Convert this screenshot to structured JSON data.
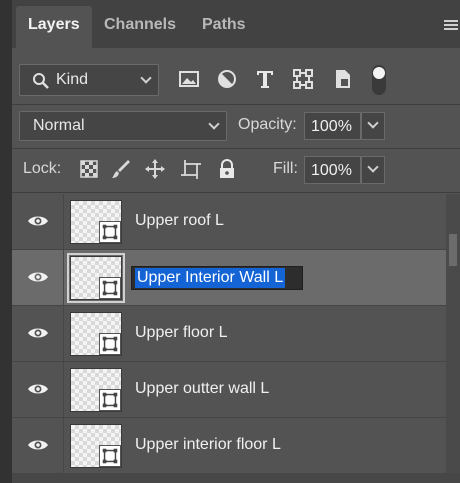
{
  "tabs": [
    {
      "label": "Layers",
      "active": true
    },
    {
      "label": "Channels",
      "active": false
    },
    {
      "label": "Paths",
      "active": false
    }
  ],
  "filter": {
    "kind_label": "Kind",
    "icons": [
      "image-filter-icon",
      "adjustment-filter-icon",
      "type-filter-icon",
      "shape-filter-icon",
      "smart-object-filter-icon",
      "filter-toggle-icon"
    ]
  },
  "blend": {
    "mode": "Normal",
    "opacity_label": "Opacity:",
    "opacity_value": "100%"
  },
  "lock": {
    "label": "Lock:",
    "icons": [
      "lock-transparent-pixels-icon",
      "lock-image-pixels-icon",
      "lock-position-icon",
      "lock-artboard-icon",
      "lock-all-icon"
    ],
    "fill_label": "Fill:",
    "fill_value": "100%"
  },
  "layers": [
    {
      "name": "Upper roof L",
      "visible": true,
      "selected": false,
      "editing": false
    },
    {
      "name": "Upper Interior Wall L",
      "visible": true,
      "selected": true,
      "editing": true
    },
    {
      "name": "Upper floor L",
      "visible": true,
      "selected": false,
      "editing": false
    },
    {
      "name": "Upper outter wall L",
      "visible": true,
      "selected": false,
      "editing": false
    },
    {
      "name": "Upper interior floor L",
      "visible": true,
      "selected": false,
      "editing": false
    }
  ],
  "colors": {
    "panel": "#535353",
    "selection": "#1464d6",
    "selected_row": "#6b6b6b"
  }
}
